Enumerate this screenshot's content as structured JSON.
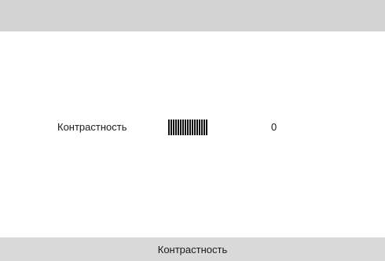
{
  "setting": {
    "label": "Контрастность",
    "value": "0",
    "level_fraction": 1.0
  },
  "footer": {
    "title": "Контрастность"
  },
  "colors": {
    "top_bar": "#d2d2d2",
    "bottom_bar": "#d9d9d9",
    "background": "#ffffff",
    "text": "#1a1a1a",
    "meter": "#111111"
  }
}
